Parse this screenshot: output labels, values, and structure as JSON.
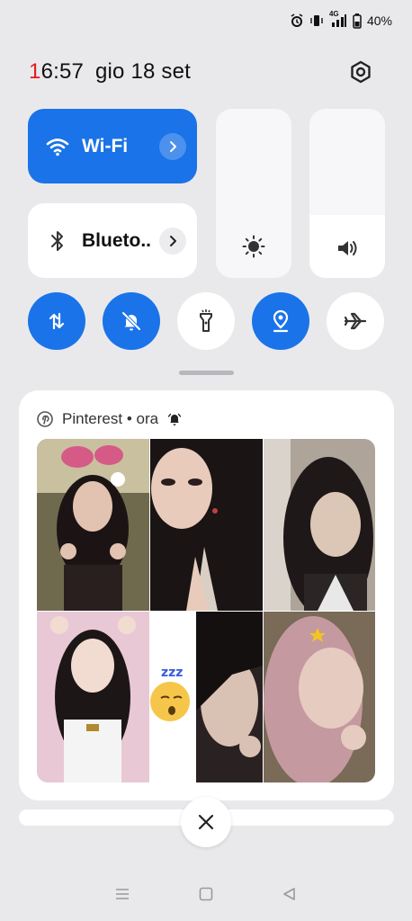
{
  "status_bar": {
    "battery_text": "40%",
    "network_label": "4G",
    "icons": [
      "alarm-icon",
      "vibrate-icon",
      "signal-icon",
      "battery-icon"
    ]
  },
  "header": {
    "time_first": "1",
    "time_rest": "6:57",
    "date": "gio 18 set"
  },
  "tiles": {
    "wifi": {
      "label": "Wi-Fi",
      "active": true
    },
    "bluetooth": {
      "label": "Blueto..",
      "active": false
    }
  },
  "sliders": {
    "brightness": {
      "level": 0.0
    },
    "volume": {
      "level": 0.37
    }
  },
  "toggles": [
    {
      "name": "mobile-data",
      "icon": "data-arrows-icon",
      "active": true
    },
    {
      "name": "silent",
      "icon": "bell-off-icon",
      "active": true
    },
    {
      "name": "flashlight",
      "icon": "flashlight-icon",
      "active": false
    },
    {
      "name": "location",
      "icon": "location-pin-icon",
      "active": true
    },
    {
      "name": "airplane",
      "icon": "airplane-icon",
      "active": false
    }
  ],
  "notification": {
    "app": "Pinterest",
    "separator": " • ",
    "time": "ora",
    "images_count": 8
  },
  "colors": {
    "accent": "#1a73e8",
    "background": "#e9e9ec",
    "clock_first_digit": "#e31b1b"
  }
}
